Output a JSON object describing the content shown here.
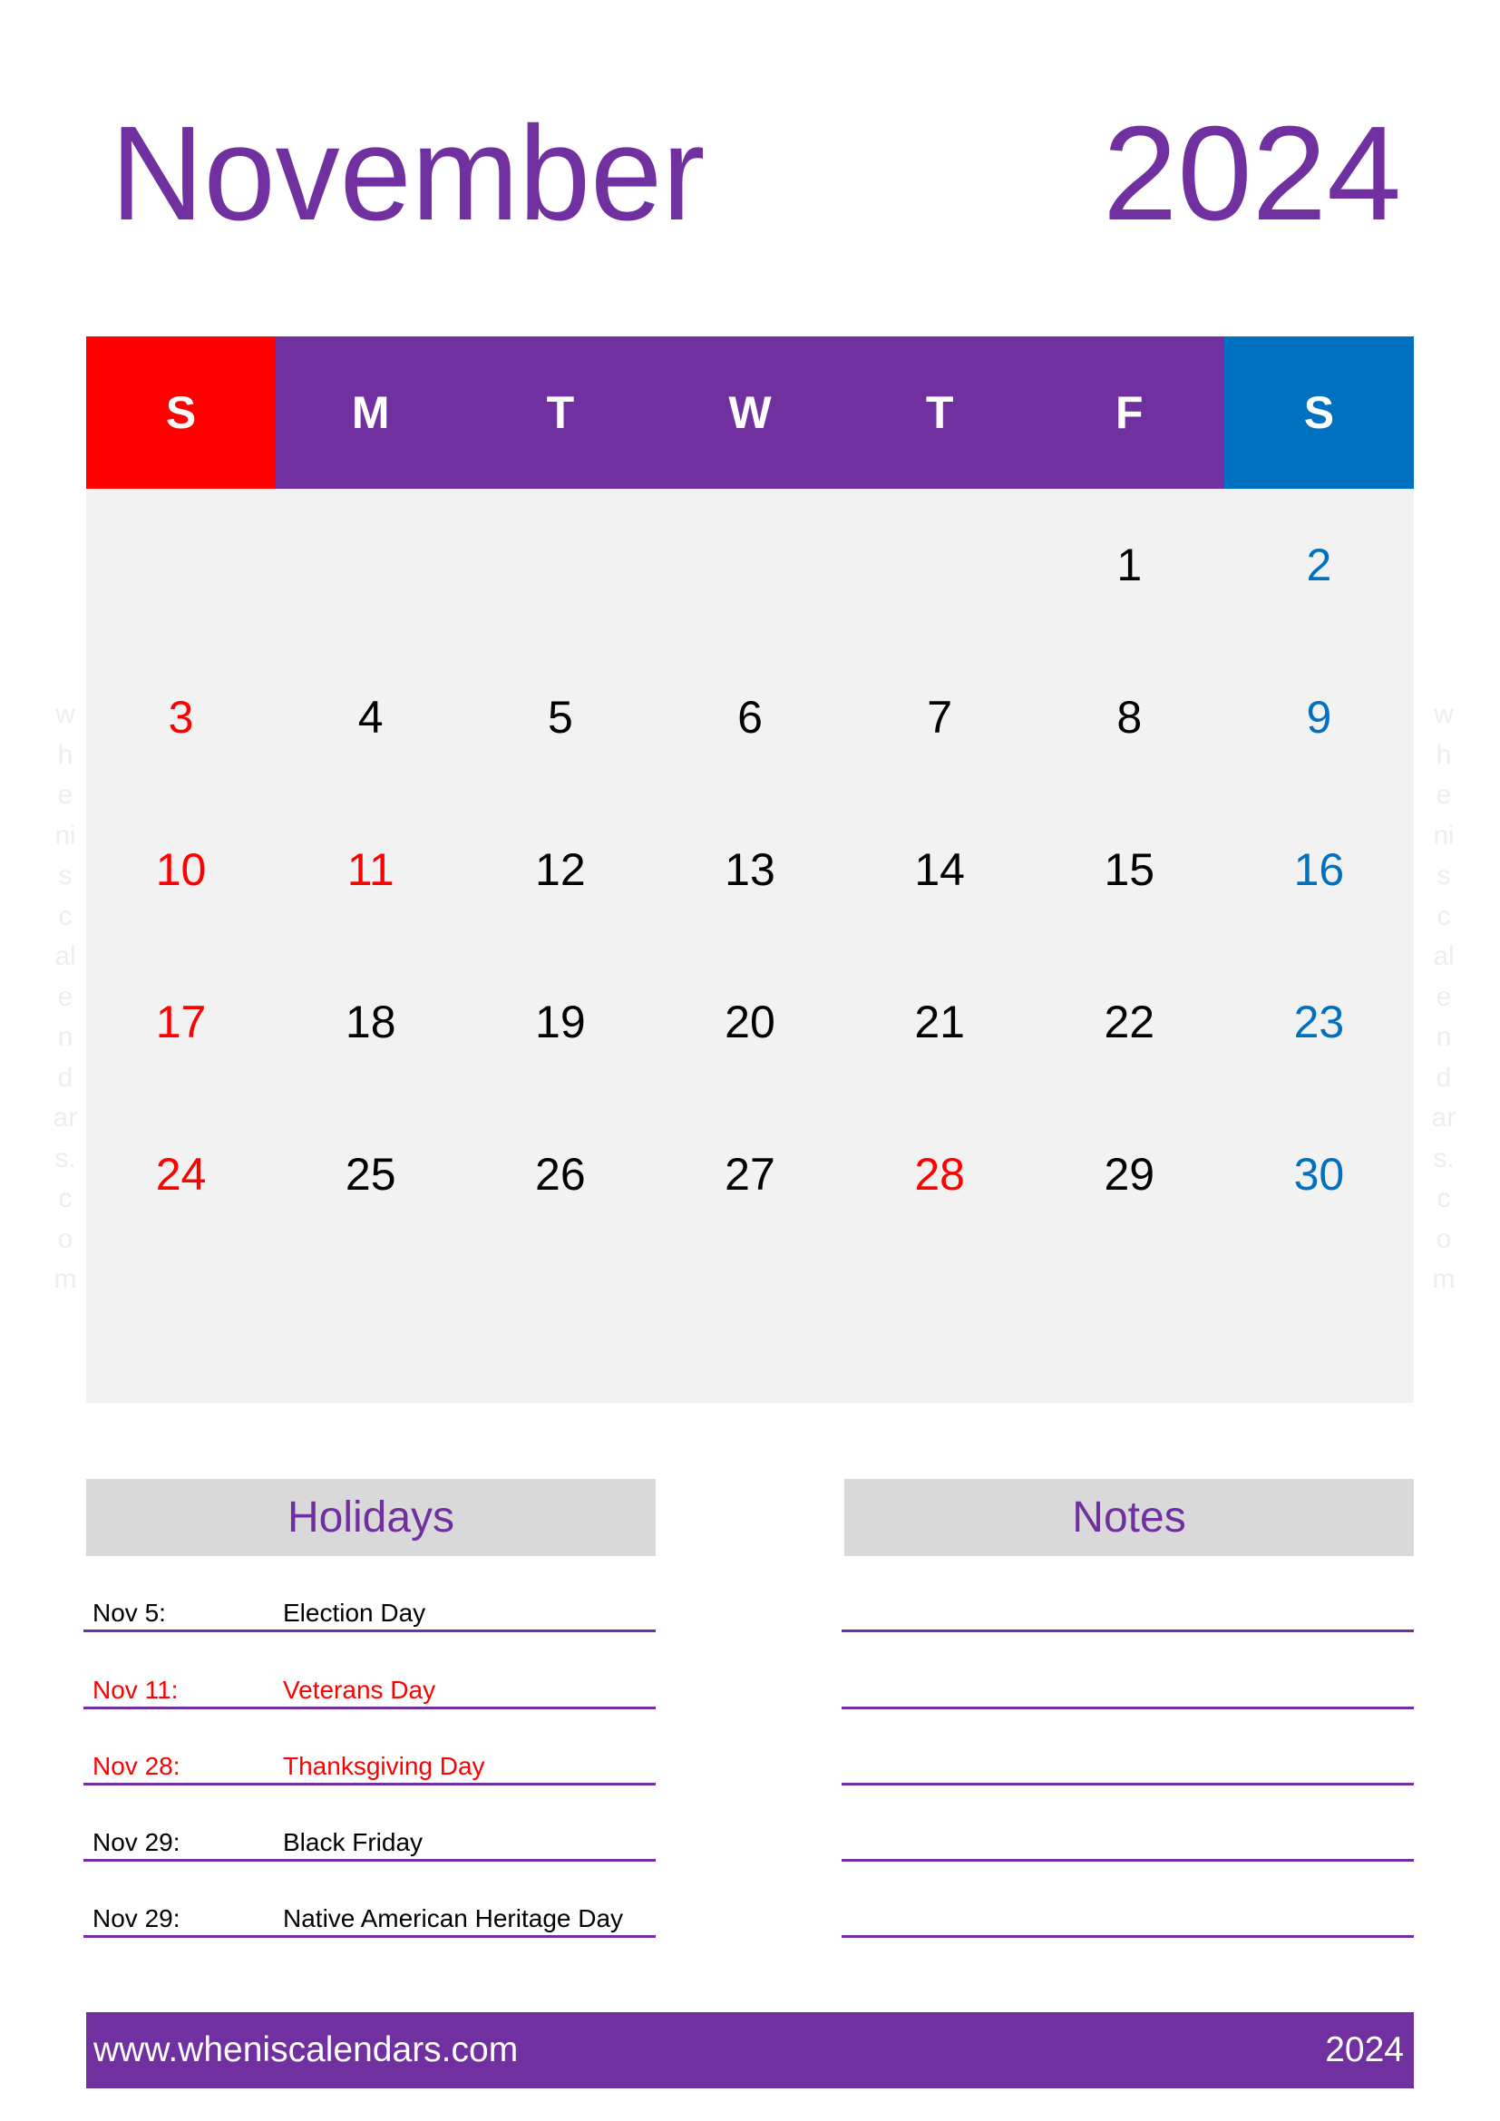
{
  "header": {
    "month": "November",
    "year": "2024"
  },
  "colors": {
    "accent_purple": "#7030a0",
    "sunday_red": "#ff0000",
    "saturday_blue": "#0070c0",
    "grid_bg": "#f2f2f2",
    "box_bg": "#d9d9d9"
  },
  "weekdays": [
    {
      "label": "S",
      "kind": "sunday"
    },
    {
      "label": "M",
      "kind": "weekday"
    },
    {
      "label": "T",
      "kind": "weekday"
    },
    {
      "label": "W",
      "kind": "weekday"
    },
    {
      "label": "T",
      "kind": "weekday"
    },
    {
      "label": "F",
      "kind": "weekday"
    },
    {
      "label": "S",
      "kind": "saturday"
    }
  ],
  "weeks": [
    [
      null,
      null,
      null,
      null,
      null,
      {
        "day": "1",
        "style": "normal"
      },
      {
        "day": "2",
        "style": "saturday"
      }
    ],
    [
      {
        "day": "3",
        "style": "red"
      },
      {
        "day": "4",
        "style": "normal"
      },
      {
        "day": "5",
        "style": "normal"
      },
      {
        "day": "6",
        "style": "normal"
      },
      {
        "day": "7",
        "style": "normal"
      },
      {
        "day": "8",
        "style": "normal"
      },
      {
        "day": "9",
        "style": "saturday"
      }
    ],
    [
      {
        "day": "10",
        "style": "red"
      },
      {
        "day": "11",
        "style": "red"
      },
      {
        "day": "12",
        "style": "normal"
      },
      {
        "day": "13",
        "style": "normal"
      },
      {
        "day": "14",
        "style": "normal"
      },
      {
        "day": "15",
        "style": "normal"
      },
      {
        "day": "16",
        "style": "saturday"
      }
    ],
    [
      {
        "day": "17",
        "style": "red"
      },
      {
        "day": "18",
        "style": "normal"
      },
      {
        "day": "19",
        "style": "normal"
      },
      {
        "day": "20",
        "style": "normal"
      },
      {
        "day": "21",
        "style": "normal"
      },
      {
        "day": "22",
        "style": "normal"
      },
      {
        "day": "23",
        "style": "saturday"
      }
    ],
    [
      {
        "day": "24",
        "style": "red"
      },
      {
        "day": "25",
        "style": "normal"
      },
      {
        "day": "26",
        "style": "normal"
      },
      {
        "day": "27",
        "style": "normal"
      },
      {
        "day": "28",
        "style": "red"
      },
      {
        "day": "29",
        "style": "normal"
      },
      {
        "day": "30",
        "style": "saturday"
      }
    ],
    [
      null,
      null,
      null,
      null,
      null,
      null,
      null
    ]
  ],
  "watermark": [
    "w",
    "h",
    "e",
    "ni",
    "s",
    "c",
    "al",
    "e",
    "n",
    "d",
    "ar",
    "s.",
    "c",
    "o",
    "m"
  ],
  "holidays": {
    "title": "Holidays",
    "items": [
      {
        "date": "Nov 5:",
        "name": "Election Day",
        "highlight": false
      },
      {
        "date": "Nov 11:",
        "name": "Veterans Day",
        "highlight": true
      },
      {
        "date": "Nov 28:",
        "name": "Thanksgiving Day",
        "highlight": true
      },
      {
        "date": "Nov 29:",
        "name": "Black Friday",
        "highlight": false
      },
      {
        "date": "Nov 29:",
        "name": "Native American Heritage Day",
        "highlight": false
      }
    ]
  },
  "notes": {
    "title": "Notes",
    "line_count": 5
  },
  "footer": {
    "url": "www.wheniscalendars.com",
    "year": "2024"
  }
}
